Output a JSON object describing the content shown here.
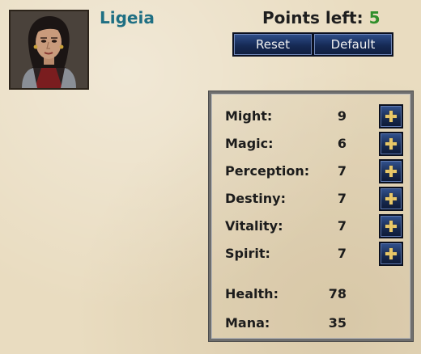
{
  "hero": {
    "name": "Ligeia",
    "portrait_icon": "hero-portrait-woman"
  },
  "points": {
    "label": "Points left:",
    "value": "5",
    "value_color": "#2f8f2a"
  },
  "buttons": {
    "reset": "Reset",
    "default": "Default"
  },
  "stats": [
    {
      "label": "Might:",
      "value": "9"
    },
    {
      "label": "Magic:",
      "value": "6"
    },
    {
      "label": "Perception:",
      "value": "7"
    },
    {
      "label": "Destiny:",
      "value": "7"
    },
    {
      "label": "Vitality:",
      "value": "7"
    },
    {
      "label": "Spirit:",
      "value": "7"
    }
  ],
  "derived": [
    {
      "label": "Health:",
      "value": "78"
    },
    {
      "label": "Mana:",
      "value": "35"
    }
  ],
  "colors": {
    "name": "#1f6f83",
    "button": "#1c3366",
    "plus": "#e8c869"
  }
}
